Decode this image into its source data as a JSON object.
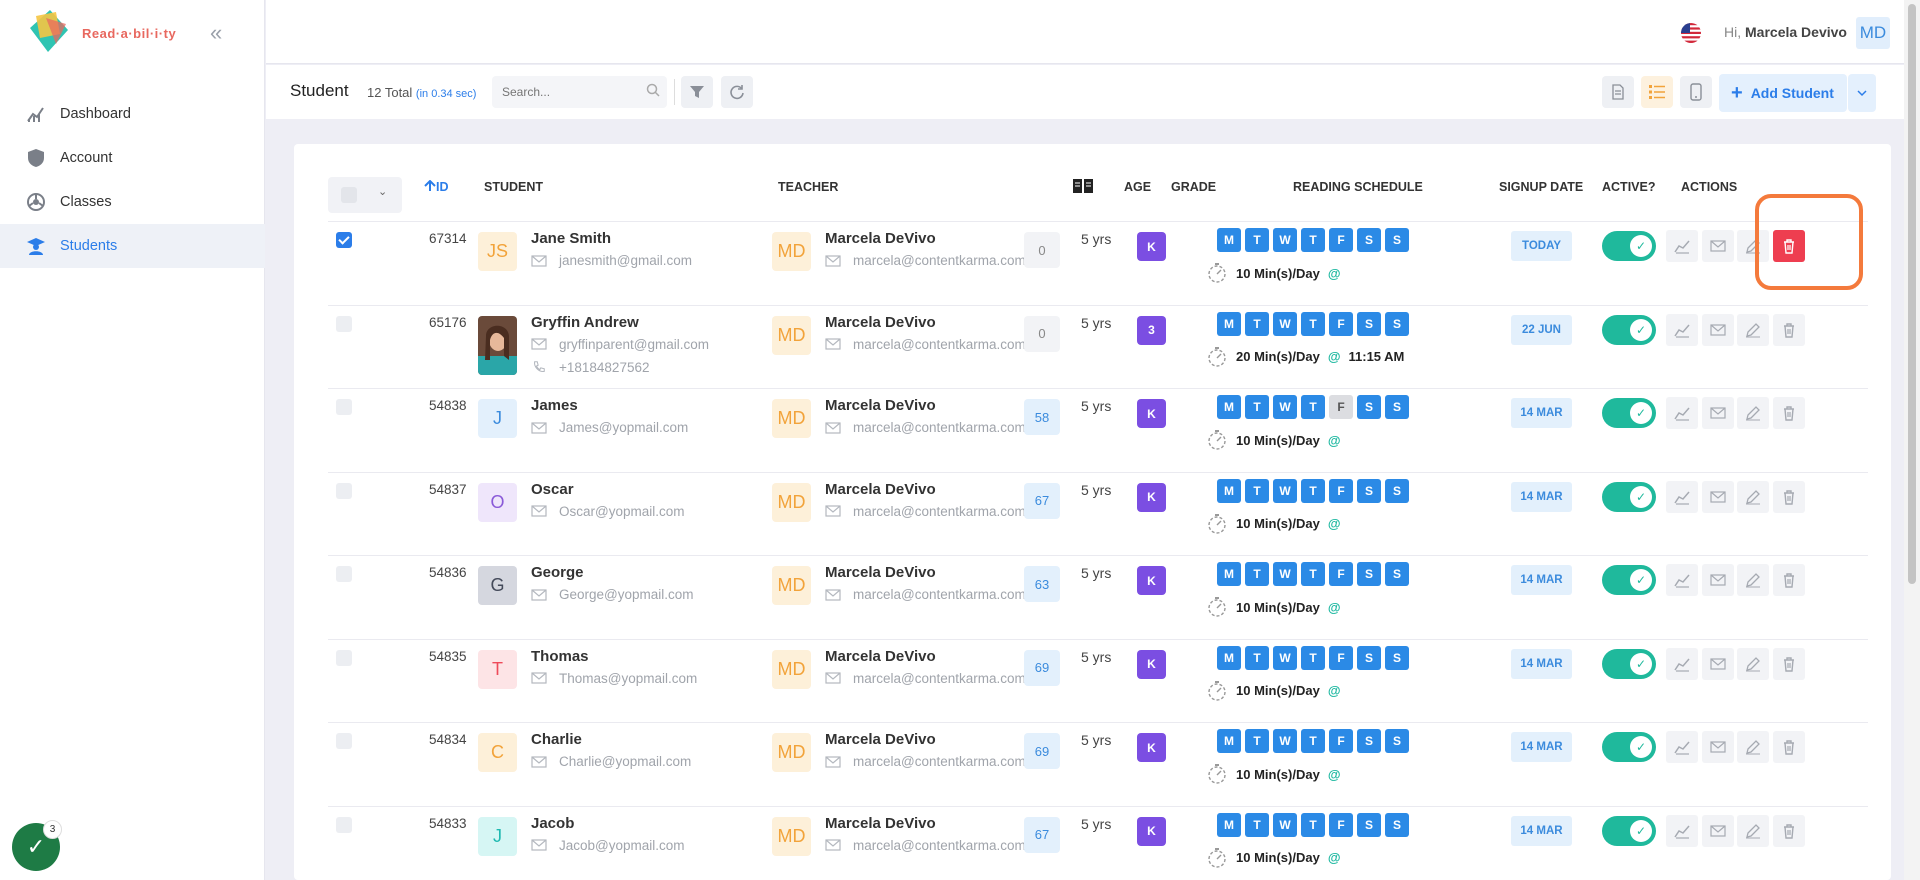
{
  "app": {
    "logo_text": "Read·a·bil·i·ty",
    "collapse_icon": "double-chevron-left-icon"
  },
  "sidebar": {
    "items": [
      {
        "label": "Dashboard",
        "icon": "chart-icon"
      },
      {
        "label": "Account",
        "icon": "shield-icon"
      },
      {
        "label": "Classes",
        "icon": "classes-icon"
      },
      {
        "label": "Students",
        "icon": "student-icon"
      }
    ],
    "active": "Students"
  },
  "fab": {
    "badge": "3"
  },
  "topbar": {
    "greeting": "Hi,",
    "user_name": "Marcela Devivo",
    "user_initials": "MD"
  },
  "toolbar": {
    "title": "Student",
    "total": "12 Total",
    "timing": "(in 0.34 sec)",
    "search_placeholder": "Search...",
    "add_label": "Add Student"
  },
  "table": {
    "headers": {
      "id": "ID",
      "student": "STUDENT",
      "teacher": "TEACHER",
      "age": "AGE",
      "grade": "GRADE",
      "schedule": "READING SCHEDULE",
      "signup": "SIGNUP DATE",
      "active": "ACTIVE?",
      "actions": "ACTIONS"
    },
    "day_letters": [
      "M",
      "T",
      "W",
      "T",
      "F",
      "S",
      "S"
    ],
    "rows": [
      {
        "checked": true,
        "id": "67314",
        "initials": "JS",
        "avatar_bg": "#fdf0d9",
        "avatar_fg": "#f2a33a",
        "name": "Jane Smith",
        "email": "janesmith@gmail.com",
        "phone": "",
        "teacher_initials": "MD",
        "teacher": "Marcela DeVivo",
        "teacher_email": "marcela@contentkarma.com",
        "books": "0",
        "age": "5 yrs",
        "grade": "K",
        "days_off": [],
        "minutes": "10 Min(s)/Day",
        "at": "@",
        "time": "",
        "signup": "TODAY"
      },
      {
        "checked": false,
        "id": "65176",
        "initials": "",
        "avatar_bg": "photo",
        "avatar_fg": "",
        "name": "Gryffin Andrew",
        "email": "gryffinparent@gmail.com",
        "phone": "+18184827562",
        "teacher_initials": "MD",
        "teacher": "Marcela DeVivo",
        "teacher_email": "marcela@contentkarma.com",
        "books": "0",
        "age": "5 yrs",
        "grade": "3",
        "days_off": [],
        "minutes": "20 Min(s)/Day",
        "at": "@",
        "time": "11:15 AM",
        "signup": "22 JUN"
      },
      {
        "checked": false,
        "id": "54838",
        "initials": "J",
        "avatar_bg": "#e3f0fc",
        "avatar_fg": "#3b8bdd",
        "name": "James",
        "email": "James@yopmail.com",
        "phone": "",
        "teacher_initials": "MD",
        "teacher": "Marcela DeVivo",
        "teacher_email": "marcela@contentkarma.com",
        "books": "58",
        "age": "5 yrs",
        "grade": "K",
        "days_off": [
          4
        ],
        "minutes": "10 Min(s)/Day",
        "at": "@",
        "time": "",
        "signup": "14 MAR"
      },
      {
        "checked": false,
        "id": "54837",
        "initials": "O",
        "avatar_bg": "#efe6fb",
        "avatar_fg": "#8a5ad8",
        "name": "Oscar",
        "email": "Oscar@yopmail.com",
        "phone": "",
        "teacher_initials": "MD",
        "teacher": "Marcela DeVivo",
        "teacher_email": "marcela@contentkarma.com",
        "books": "67",
        "age": "5 yrs",
        "grade": "K",
        "days_off": [],
        "minutes": "10 Min(s)/Day",
        "at": "@",
        "time": "",
        "signup": "14 MAR"
      },
      {
        "checked": false,
        "id": "54836",
        "initials": "G",
        "avatar_bg": "#d5d7df",
        "avatar_fg": "#444a5a",
        "name": "George",
        "email": "George@yopmail.com",
        "phone": "",
        "teacher_initials": "MD",
        "teacher": "Marcela DeVivo",
        "teacher_email": "marcela@contentkarma.com",
        "books": "63",
        "age": "5 yrs",
        "grade": "K",
        "days_off": [],
        "minutes": "10 Min(s)/Day",
        "at": "@",
        "time": "",
        "signup": "14 MAR"
      },
      {
        "checked": false,
        "id": "54835",
        "initials": "T",
        "avatar_bg": "#fde4e6",
        "avatar_fg": "#ee4a5a",
        "name": "Thomas",
        "email": "Thomas@yopmail.com",
        "phone": "",
        "teacher_initials": "MD",
        "teacher": "Marcela DeVivo",
        "teacher_email": "marcela@contentkarma.com",
        "books": "69",
        "age": "5 yrs",
        "grade": "K",
        "days_off": [],
        "minutes": "10 Min(s)/Day",
        "at": "@",
        "time": "",
        "signup": "14 MAR"
      },
      {
        "checked": false,
        "id": "54834",
        "initials": "C",
        "avatar_bg": "#fdf0d9",
        "avatar_fg": "#f2a33a",
        "name": "Charlie",
        "email": "Charlie@yopmail.com",
        "phone": "",
        "teacher_initials": "MD",
        "teacher": "Marcela DeVivo",
        "teacher_email": "marcela@contentkarma.com",
        "books": "69",
        "age": "5 yrs",
        "grade": "K",
        "days_off": [],
        "minutes": "10 Min(s)/Day",
        "at": "@",
        "time": "",
        "signup": "14 MAR"
      },
      {
        "checked": false,
        "id": "54833",
        "initials": "J",
        "avatar_bg": "#d6f6f4",
        "avatar_fg": "#1fb9b0",
        "name": "Jacob",
        "email": "Jacob@yopmail.com",
        "phone": "",
        "teacher_initials": "MD",
        "teacher": "Marcela DeVivo",
        "teacher_email": "marcela@contentkarma.com",
        "books": "67",
        "age": "5 yrs",
        "grade": "K",
        "days_off": [],
        "minutes": "10 Min(s)/Day",
        "at": "@",
        "time": "",
        "signup": "14 MAR"
      }
    ]
  },
  "colors": {
    "accent": "#2b7de9",
    "toggle_on": "#1fb99c",
    "delete_active": "#ee3e50",
    "highlight": "#f47a3c",
    "grade_badge": "#7b4ee2"
  }
}
